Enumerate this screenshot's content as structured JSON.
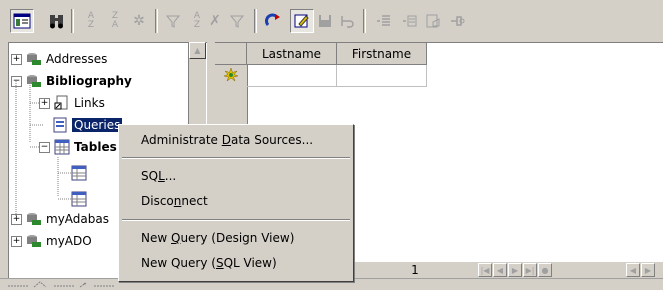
{
  "toolbar": {
    "icons": [
      "explorer-toggle-icon",
      "find-icon",
      "sort-ascending-icon",
      "sort-descending-icon",
      "auto-sort-icon",
      "auto-filter-icon",
      "standard-filter-icon",
      "filter-icon",
      "remove-filter-icon",
      "refresh-icon",
      "edit-data-icon",
      "save-record-icon",
      "undo-icon",
      "data-to-text-icon",
      "data-to-fields-icon",
      "mail-merge-icon",
      "data-source-icon"
    ]
  },
  "tree": {
    "items": [
      {
        "label": "Addresses",
        "expander": "+",
        "bold": false
      },
      {
        "label": "Bibliography",
        "expander": "−",
        "bold": true
      },
      {
        "label": "Links",
        "expander": "+",
        "bold": false
      },
      {
        "label": "Queries",
        "expander": "",
        "bold": false,
        "selected": true
      },
      {
        "label": "Tables",
        "expander": "−",
        "bold": true
      },
      {
        "label": "",
        "expander": "",
        "bold": false
      },
      {
        "label": "",
        "expander": "",
        "bold": false
      },
      {
        "label": "myAdabas",
        "expander": "+",
        "bold": false
      },
      {
        "label": "myADO",
        "expander": "+",
        "bold": false
      }
    ]
  },
  "grid": {
    "columns": [
      "Lastname",
      "Firstname"
    ]
  },
  "nav": {
    "record_number": "1"
  },
  "context_menu": {
    "items": [
      {
        "label": "Administrate Data Sources...",
        "mnemonic": "D"
      },
      {
        "label": "SQL...",
        "mnemonic": "L"
      },
      {
        "label": "Disconnect",
        "mnemonic": "n"
      },
      {
        "label": "New Query (Design View)",
        "mnemonic": "Q"
      },
      {
        "label": "New Query (SQL View)",
        "mnemonic": "S"
      }
    ]
  }
}
